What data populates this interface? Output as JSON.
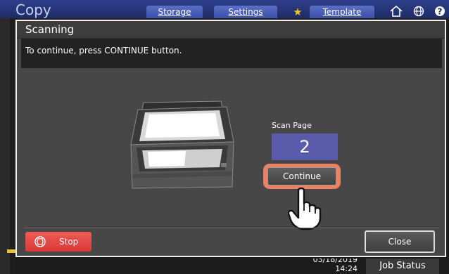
{
  "app": {
    "title": "Copy",
    "tabs": [
      {
        "label": "Storage"
      },
      {
        "label": "Settings"
      },
      {
        "label": "Template"
      }
    ],
    "icons": [
      "star-icon",
      "home-icon",
      "globe-icon",
      "help-icon"
    ]
  },
  "dialog": {
    "title": "Scanning",
    "message": "To continue, press CONTINUE button.",
    "scan_page_label": "Scan Page",
    "scan_page_value": "2",
    "continue_label": "Continue",
    "stop_label": "Stop",
    "close_label": "Close"
  },
  "status": {
    "date": "03/18/2019",
    "time": "14:24",
    "job_status_label": "Job Status"
  },
  "colors": {
    "accent_blue": "#3b4fa6",
    "page_box": "#5b5bab",
    "stop_red": "#e0413e",
    "highlight": "#ee8163"
  }
}
